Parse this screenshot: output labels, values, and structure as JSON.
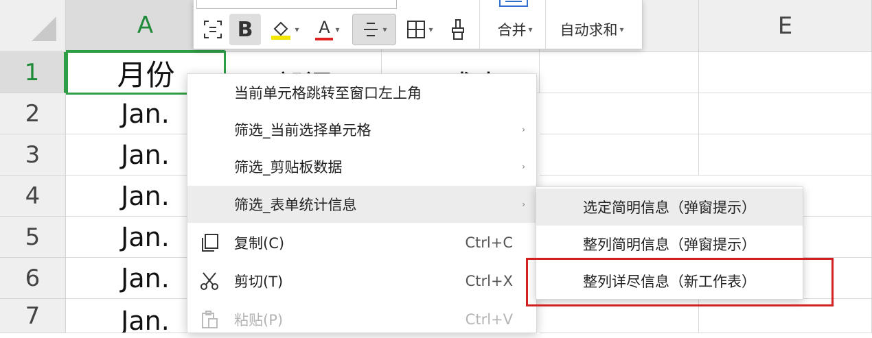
{
  "columns": [
    "A",
    "",
    "",
    "",
    "E"
  ],
  "rows": [
    "1",
    "2",
    "3",
    "4",
    "5",
    "6",
    "7"
  ],
  "cells": {
    "header": [
      "月份",
      "部门",
      "成本"
    ],
    "col_a": [
      "Jan.",
      "Jan.",
      "Jan.",
      "Jan.",
      "Jan.",
      "Jan."
    ]
  },
  "toolbar": {
    "merge_label": "合并",
    "autosum_label": "自动求和",
    "bold_label": "B",
    "font_color_label": "A"
  },
  "context_menu": {
    "items": [
      {
        "label": "当前单元格跳转至窗口左上角",
        "shortcut": "",
        "submenu": false
      },
      {
        "label": "筛选_当前选择单元格",
        "shortcut": "",
        "submenu": true
      },
      {
        "label": "筛选_剪贴板数据",
        "shortcut": "",
        "submenu": true
      },
      {
        "label": "筛选_表单统计信息",
        "shortcut": "",
        "submenu": true
      },
      {
        "label": "复制(C)",
        "shortcut": "Ctrl+C",
        "submenu": false,
        "icon": "copy-icon"
      },
      {
        "label": "剪切(T)",
        "shortcut": "Ctrl+X",
        "submenu": false,
        "icon": "scissors-icon"
      },
      {
        "label": "粘贴(P)",
        "shortcut": "Ctrl+V",
        "submenu": false,
        "icon": "paste-icon"
      }
    ],
    "submenu_arrow": "›"
  },
  "submenu": {
    "items": [
      {
        "label": "选定简明信息（弹窗提示）"
      },
      {
        "label": "整列简明信息（弹窗提示）"
      },
      {
        "label": "整列详尽信息（新工作表）"
      }
    ]
  },
  "colors": {
    "selection_green": "#2e9e46",
    "highlight_red": "#d0201f",
    "font_color_red": "#e02020",
    "highlight_yellow": "#f2e600"
  }
}
